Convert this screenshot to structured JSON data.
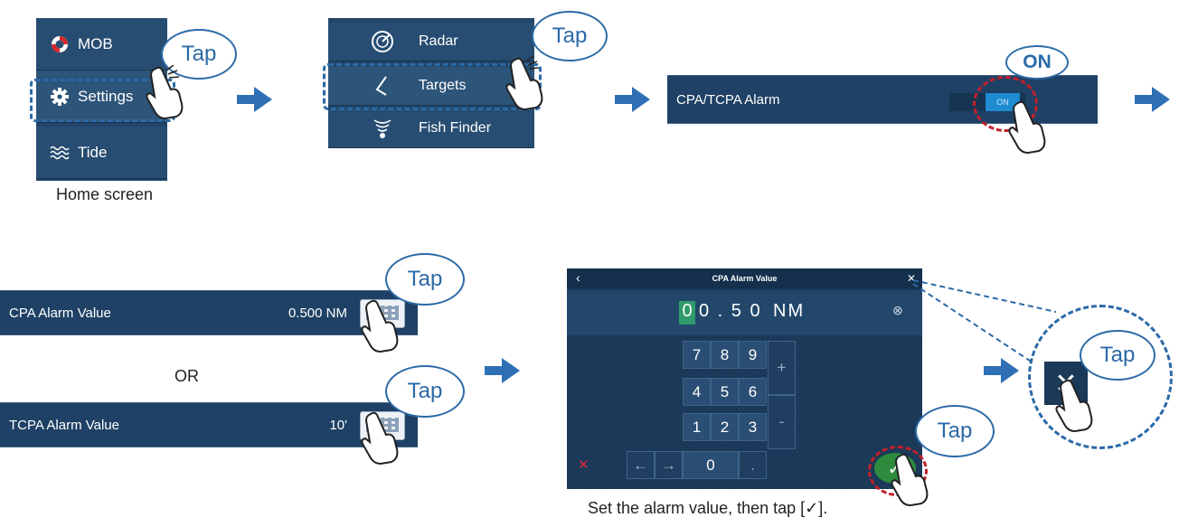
{
  "home_screen": {
    "items": [
      {
        "label": "MOB",
        "icon": "lifebuoy-icon"
      },
      {
        "label": "Settings",
        "icon": "gear-icon"
      },
      {
        "label": "Tide",
        "icon": "waves-icon"
      }
    ],
    "caption": "Home screen"
  },
  "settings_menu": {
    "items": [
      {
        "label": "Radar",
        "icon": "radar-icon"
      },
      {
        "label": "Targets",
        "icon": "triangle-target-icon"
      },
      {
        "label": "Fish Finder",
        "icon": "fish-finder-icon"
      }
    ]
  },
  "alarm_toggle": {
    "label": "CPA/TCPA Alarm",
    "state": "ON",
    "callout": "ON"
  },
  "cpa_row": {
    "label": "CPA Alarm Value",
    "value": "0.500 NM"
  },
  "or_text": "OR",
  "tcpa_row": {
    "label": "TCPA Alarm Value",
    "value": "10'"
  },
  "keypad": {
    "title": "CPA Alarm Value",
    "back": "‹",
    "close": "✕",
    "entry_highlight": "0",
    "entry_rest": "0 . 5 0",
    "unit": "NM",
    "clear": "⊗",
    "keys": [
      "7",
      "8",
      "9",
      "4",
      "5",
      "6",
      "1",
      "2",
      "3"
    ],
    "zero": "0",
    "dot": ".",
    "plus": "+",
    "minus": "-",
    "left": "←",
    "right": "→",
    "cancel": "✕",
    "confirm": "✓"
  },
  "tap_label": "Tap",
  "bottom_caption": "Set the alarm value, then tap [✓].",
  "colors": {
    "panel": "#22456a",
    "accent": "#2b6aa7",
    "arrow": "#2f6fb5",
    "ring": "#c0202a",
    "confirm": "#2e8b3e"
  }
}
